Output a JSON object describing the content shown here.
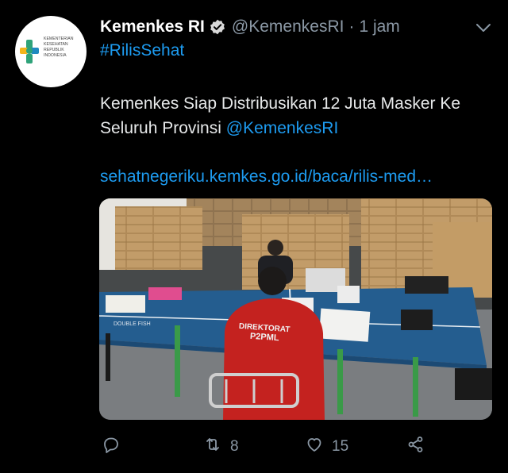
{
  "tweet": {
    "display_name": "Kemenkes RI",
    "handle": "@KemenkesRI",
    "separator": "·",
    "time": "1 jam",
    "hashtag": "#RilisSehat",
    "text": "Kemenkes Siap Distribusikan 12 Juta Masker Ke Seluruh Provinsi ",
    "mention": "@KemenkesRI",
    "link": "sehatnegeriku.kemkes.go.id/baca/rilis-med…",
    "avatar_logo_text": [
      "KEMENTERIAN",
      "KESEHATAN",
      "REPUBLIK",
      "INDONESIA"
    ],
    "photo_text": {
      "shirt": [
        "DIREKTORAT",
        "P2PML"
      ],
      "table_label": "DOUBLE FISH"
    }
  },
  "actions": {
    "reply_count": "",
    "retweet_count": "8",
    "like_count": "15"
  },
  "icons": {
    "verified": "verified-badge-icon",
    "menu": "chevron-down-icon",
    "reply": "reply-icon",
    "retweet": "retweet-icon",
    "like": "heart-icon",
    "share": "share-icon"
  },
  "colors": {
    "background": "#000000",
    "accent": "#1d9bf0",
    "muted": "#8b98a5",
    "logo_green": "#2fa37a",
    "logo_blue": "#1f8ac0"
  }
}
